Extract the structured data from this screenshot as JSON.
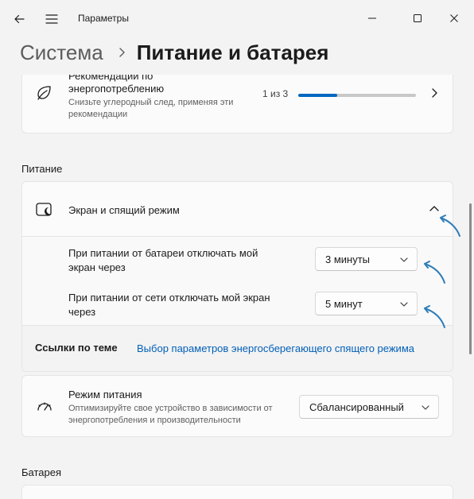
{
  "window": {
    "title": "Параметры"
  },
  "breadcrumb": {
    "parent": "Система",
    "current": "Питание и батарея"
  },
  "recommendations": {
    "title": "Рекомендации по энергопотреблению",
    "subtitle": "Снизьте углеродный след, применяя эти рекомендации",
    "count": "1 из 3",
    "progress": 0.33
  },
  "sections": {
    "power": "Питание",
    "battery": "Батарея"
  },
  "screen_sleep": {
    "label": "Экран и спящий режим",
    "battery_label": "При питании от батареи отключать мой экран через",
    "battery_value": "3 минуты",
    "ac_label": "При питании от сети отключать мой экран через",
    "ac_value": "5 минут",
    "related_label": "Ссылки по теме",
    "related_link": "Выбор параметров энергосберегающего спящего режима"
  },
  "power_mode": {
    "title": "Режим питания",
    "subtitle": "Оптимизируйте свое устройство в зависимости от энергопотребления и производительности",
    "value": "Сбалансированный"
  },
  "colors": {
    "accent": "#0067c0",
    "link": "#005fb8",
    "annotation_arrow": "#2f7db8"
  }
}
